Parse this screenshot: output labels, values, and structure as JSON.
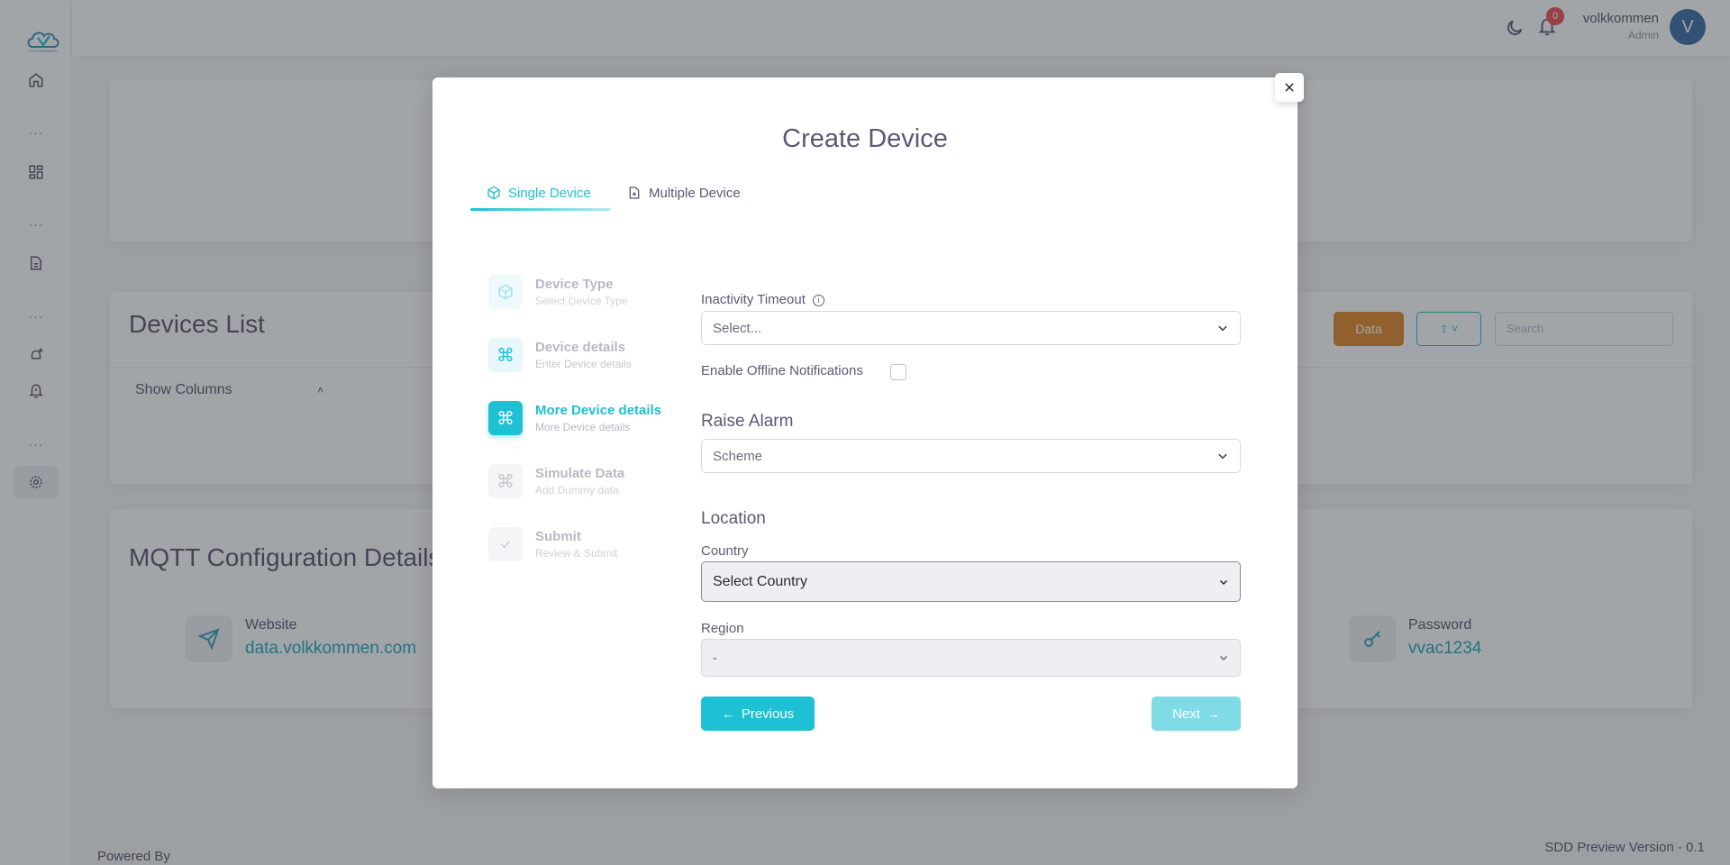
{
  "sidebar": {
    "logo_text": "VOLKKOMMEN",
    "icons": [
      "home-icon",
      "grid-icon",
      "file-icon",
      "gear-alert-icon",
      "bell-icon",
      "settings-icon"
    ]
  },
  "topbar": {
    "notification_count": "0",
    "user_name": "volkkommen",
    "user_role": "Admin",
    "avatar_initial": "V"
  },
  "devices_card": {
    "title": "Devices List",
    "data_button": "Data",
    "search_placeholder": "Search",
    "show_columns": "Show Columns"
  },
  "mqtt_card": {
    "title": "MQTT Configuration Details",
    "website_label": "Website",
    "website_value": "data.volkkommen.com",
    "password_label": "Password",
    "password_value": "vvac1234"
  },
  "footer": {
    "powered_by": "Powered By",
    "version": "SDD Preview Version - 0.1"
  },
  "modal": {
    "title": "Create Device",
    "tabs": [
      {
        "label": "Single Device",
        "active": true
      },
      {
        "label": "Multiple Device",
        "active": false
      }
    ],
    "steps": [
      {
        "title": "Device Type",
        "subtitle": "Select Device Type",
        "state": "done"
      },
      {
        "title": "Device details",
        "subtitle": "Enter Device details",
        "state": "done"
      },
      {
        "title": "More Device details",
        "subtitle": "More Device details",
        "state": "active"
      },
      {
        "title": "Simulate Data",
        "subtitle": "Add Dummy data",
        "state": "pending"
      },
      {
        "title": "Submit",
        "subtitle": "Review & Submit",
        "state": "pending"
      }
    ],
    "form": {
      "inactivity_label": "Inactivity Timeout",
      "inactivity_value": "Select...",
      "offline_label": "Enable Offline Notifications",
      "raise_alarm_title": "Raise Alarm",
      "scheme_value": "Scheme",
      "location_title": "Location",
      "country_label": "Country",
      "country_value": "Select Country",
      "region_label": "Region",
      "region_value": "-"
    },
    "buttons": {
      "previous": "Previous",
      "next": "Next"
    }
  },
  "colors": {
    "accent": "#1ec0d4",
    "accent_light": "#7fdbe6",
    "orange": "#e08a2e",
    "text": "#5e5873",
    "badge": "#ea5455"
  }
}
